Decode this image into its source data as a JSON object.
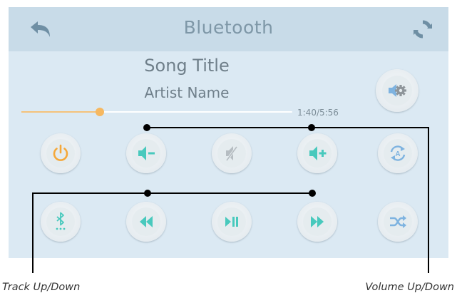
{
  "header": {
    "title": "Bluetooth"
  },
  "player": {
    "song_title": "Song Title",
    "artist_name": "Artist Name",
    "time": "1:40/5:56",
    "progress_fraction": 0.29
  },
  "annotations": {
    "track_label": "Track Up/Down",
    "volume_label": "Volume Up/Down"
  },
  "colors": {
    "header_bg": "#c8dbe8",
    "screen_bg": "#dbe9f3",
    "power": "#f5a83a",
    "teal": "#48c9bd",
    "blue": "#7eb3e0",
    "gray": "#b6bdc2"
  }
}
